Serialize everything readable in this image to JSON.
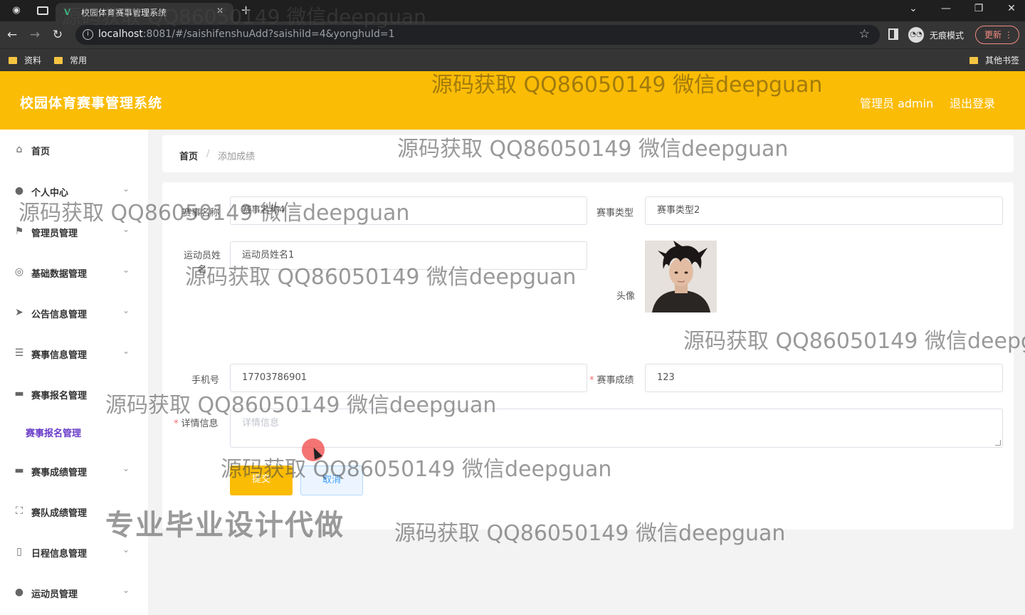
{
  "browser": {
    "tab_title": "校园体育赛事管理系统",
    "url_host": "localhost",
    "url_rest": ":8081/#/saishifenshuAdd?saishiId=4&yonghuId=1",
    "incognito_label": "无痕模式",
    "update_label": "更新",
    "bookmarks": [
      "资料",
      "常用"
    ],
    "other_bookmarks": "其他书签"
  },
  "header": {
    "title": "校园体育赛事管理系统",
    "admin": "管理员 admin",
    "logout": "退出登录"
  },
  "sidebar": {
    "items": [
      {
        "label": "首页",
        "icon": "home-icon"
      },
      {
        "label": "个人中心",
        "icon": "user-icon"
      },
      {
        "label": "管理员管理",
        "icon": "flag-icon"
      },
      {
        "label": "基础数据管理",
        "icon": "target-icon"
      },
      {
        "label": "公告信息管理",
        "icon": "send-icon"
      },
      {
        "label": "赛事信息管理",
        "icon": "sliders-icon"
      },
      {
        "label": "赛事报名管理",
        "icon": "monitor-icon"
      },
      {
        "label": "赛事成绩管理",
        "icon": "monitor-icon"
      },
      {
        "label": "赛队成绩管理",
        "icon": "frame-icon"
      },
      {
        "label": "日程信息管理",
        "icon": "phone-icon"
      },
      {
        "label": "运动员管理",
        "icon": "location-icon"
      }
    ],
    "submenu": "赛事报名管理"
  },
  "breadcrumb": {
    "home": "首页",
    "separator": "/",
    "current": "添加成绩"
  },
  "form": {
    "event_name_label": "赛事名称",
    "event_name_value": "赛事名称4",
    "event_type_label": "赛事类型",
    "event_type_value": "赛事类型2",
    "athlete_label": "运动员姓名",
    "athlete_value": "运动员姓名1",
    "avatar_label": "头像",
    "phone_label": "手机号",
    "phone_value": "17703786901",
    "score_label": "赛事成绩",
    "score_value": "123",
    "detail_label": "详情信息",
    "detail_placeholder": "详情信息",
    "required_mark": "*",
    "submit": "提交",
    "cancel": "取消"
  },
  "watermarks": {
    "text": "源码获取 QQ86050149 微信deepguan",
    "text_cut": "源码获取 QQ86050149 微信deepg",
    "big": "专业毕业设计代做"
  }
}
